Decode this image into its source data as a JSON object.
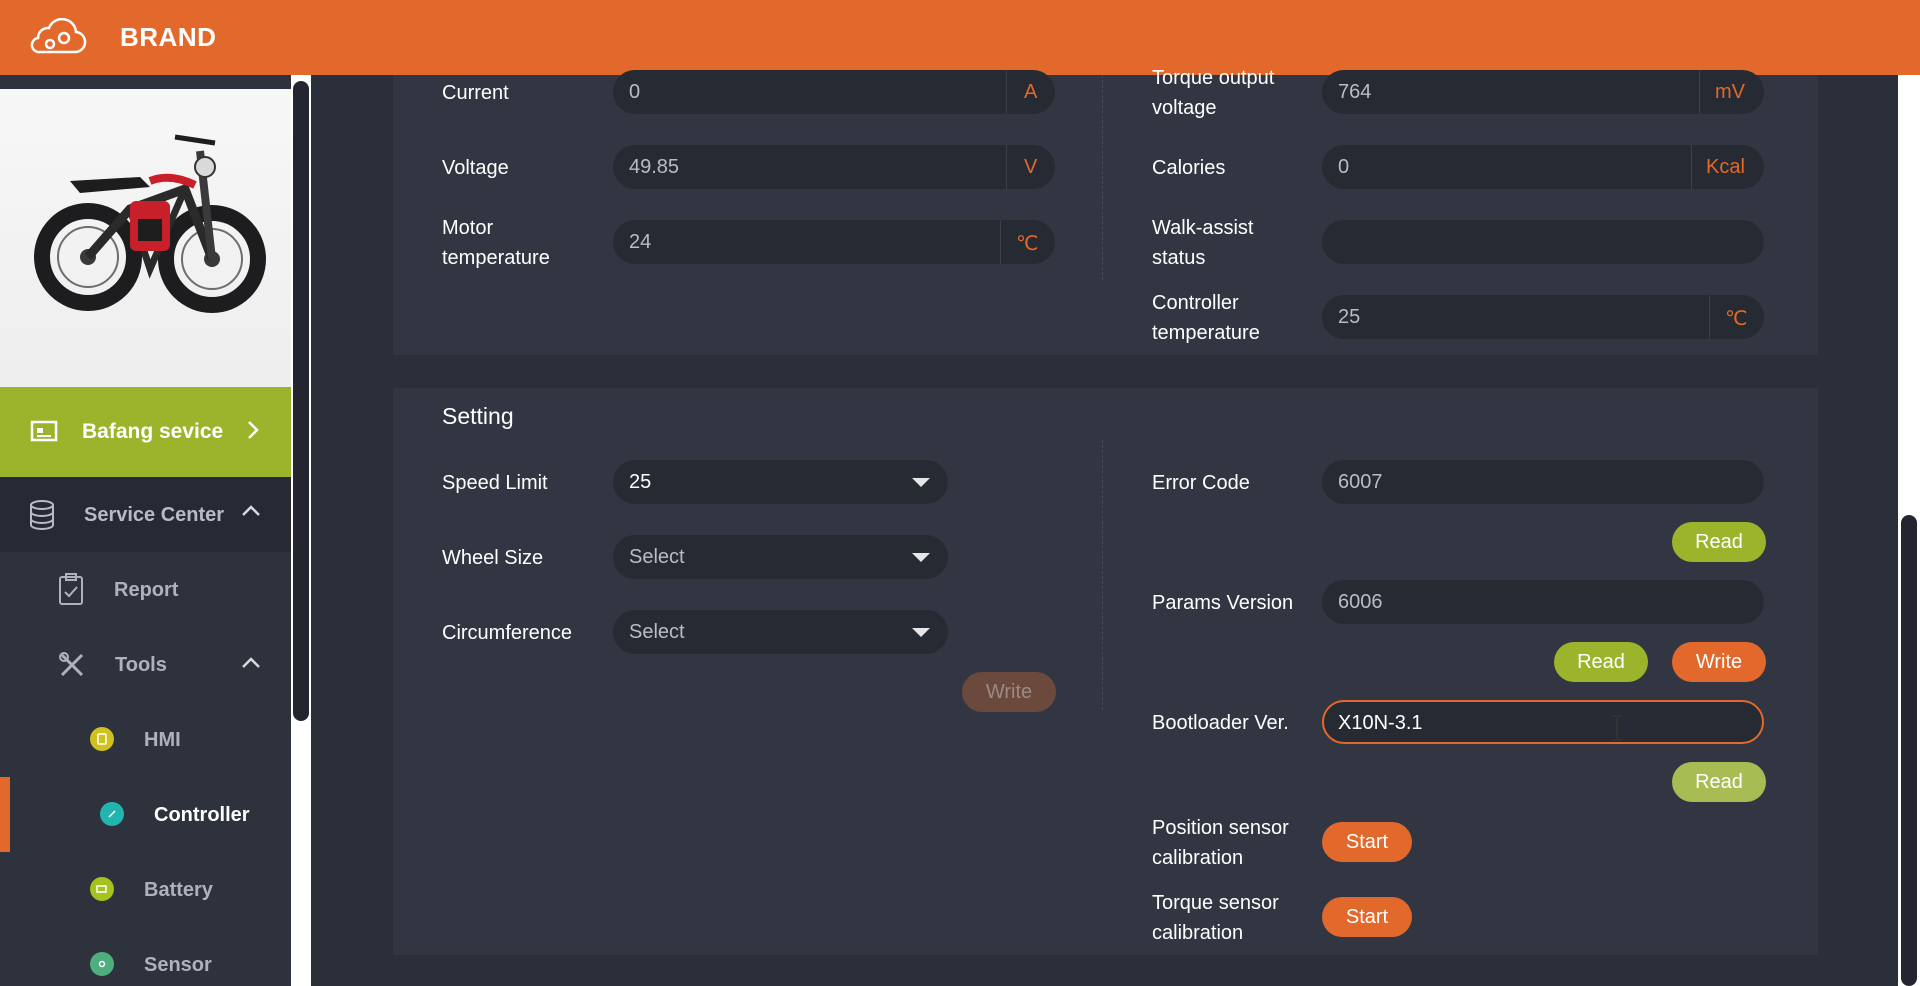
{
  "header": {
    "brand": "BRAND",
    "logo_icon": "cloud-gear-icon"
  },
  "sidebar": {
    "bafang_label": "Bafang sevice",
    "service_center_label": "Service Center",
    "report_label": "Report",
    "tools_label": "Tools",
    "hmi_label": "HMI",
    "controller_label": "Controller",
    "battery_label": "Battery",
    "sensor_label": "Sensor"
  },
  "realtime": {
    "current": {
      "label": "Current",
      "value": "0",
      "unit": "A"
    },
    "voltage": {
      "label": "Voltage",
      "value": "49.85",
      "unit": "V"
    },
    "motor_temp": {
      "label_line1": "Motor",
      "label_line2": "temperature",
      "value": "24",
      "unit": "℃"
    },
    "torque_output": {
      "label_line1": "Torque output",
      "label_line2": "voltage",
      "value": "764",
      "unit": "mV"
    },
    "calories": {
      "label": "Calories",
      "value": "0",
      "unit": "Kcal"
    },
    "walk_assist": {
      "label_line1": "Walk-assist",
      "label_line2": "status",
      "value": ""
    },
    "controller_temp": {
      "label_line1": "Controller",
      "label_line2": "temperature",
      "value": "25",
      "unit": "℃"
    }
  },
  "setting": {
    "title": "Setting",
    "speed_limit": {
      "label": "Speed Limit",
      "value": "25"
    },
    "wheel_size": {
      "label": "Wheel Size",
      "placeholder": "Select"
    },
    "circumference": {
      "label": "Circumference",
      "placeholder": "Select"
    },
    "write_label": "Write",
    "error_code": {
      "label": "Error Code",
      "value": "6007",
      "read_label": "Read"
    },
    "params_version": {
      "label": "Params Version",
      "value": "6006",
      "read_label": "Read",
      "write_label": "Write"
    },
    "bootloader": {
      "label": "Bootloader Ver.",
      "value": "X10N-3.1",
      "read_label": "Read"
    },
    "position_sensor": {
      "label_line1": "Position sensor",
      "label_line2": "calibration",
      "start_label": "Start"
    },
    "torque_sensor": {
      "label_line1": "Torque sensor",
      "label_line2": "calibration",
      "start_label": "Start"
    }
  },
  "colors": {
    "accent": "#e2692b",
    "green": "#9bb42c",
    "panel": "#323642",
    "field": "#262a33"
  }
}
